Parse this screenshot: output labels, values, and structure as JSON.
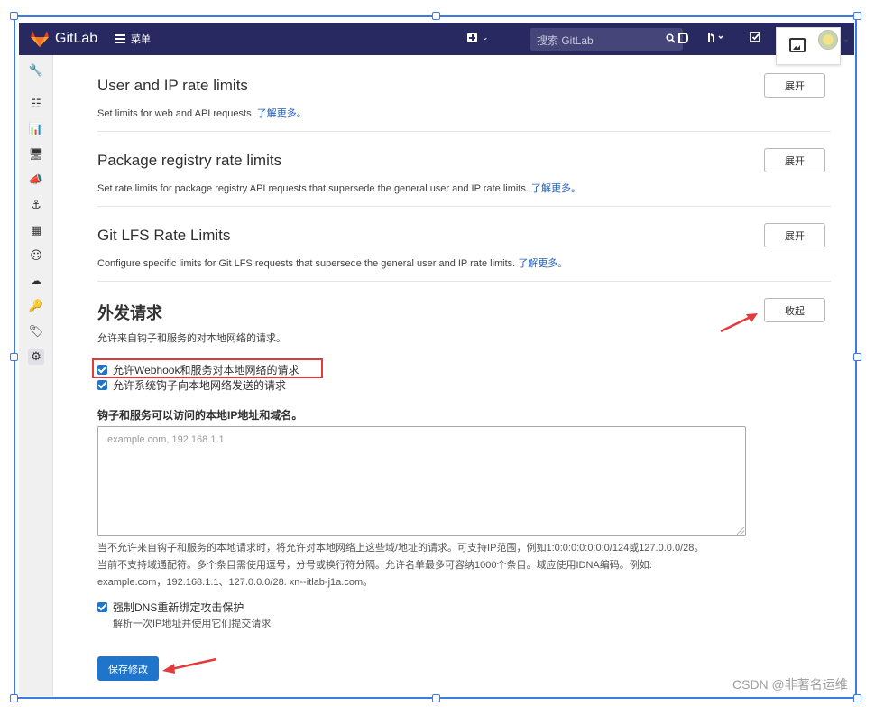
{
  "navbar": {
    "brand": "GitLab",
    "menu_label": "菜单",
    "search_placeholder": "搜索 GitLab"
  },
  "sections": [
    {
      "title": "User and IP rate limits",
      "desc": "Set limits for web and API requests.",
      "link": "了解更多。",
      "button": "展开"
    },
    {
      "title": "Package registry rate limits",
      "desc": "Set rate limits for package registry API requests that supersede the general user and IP rate limits.",
      "link": "了解更多。",
      "button": "展开"
    },
    {
      "title": "Git LFS Rate Limits",
      "desc": "Configure specific limits for Git LFS requests that supersede the general user and IP rate limits.",
      "link": "了解更多。",
      "button": "展开"
    }
  ],
  "outbound": {
    "title": "外发请求",
    "desc": "允许来自钩子和服务的对本地网络的请求。",
    "collapse_button": "收起",
    "checkbox_webhook": "允许Webhook和服务对本地网络的请求",
    "checkbox_system_hooks": "允许系统钩子向本地网络发送的请求",
    "allowlist_label": "钩子和服务可以访问的本地IP地址和域名。",
    "allowlist_placeholder": "example.com, 192.168.1.1",
    "help_line1": "当不允许来自钩子和服务的本地请求时，将允许对本地网络上这些域/地址的请求。可支持IP范围，例如1:0:0:0:0:0:0:0/124或127.0.0.0/28。",
    "help_line2": "当前不支持域通配符。多个条目需使用逗号，分号或换行符分隔。允许名单最多可容纳1000个条目。域应使用IDNA编码。例如:",
    "help_line3": "example.com，192.168.1.1、127.0.0.0/28. xn--itlab-j1a.com。",
    "dns_checkbox": "强制DNS重新绑定攻击保护",
    "dns_help": "解析一次IP地址并使用它们提交请求",
    "save_button": "保存修改"
  },
  "watermark": "CSDN @非著名运维",
  "colors": {
    "navbar": "#292961",
    "primary": "#1f75cb",
    "annotation": "#e23b3b",
    "frame": "#3b7be6"
  }
}
